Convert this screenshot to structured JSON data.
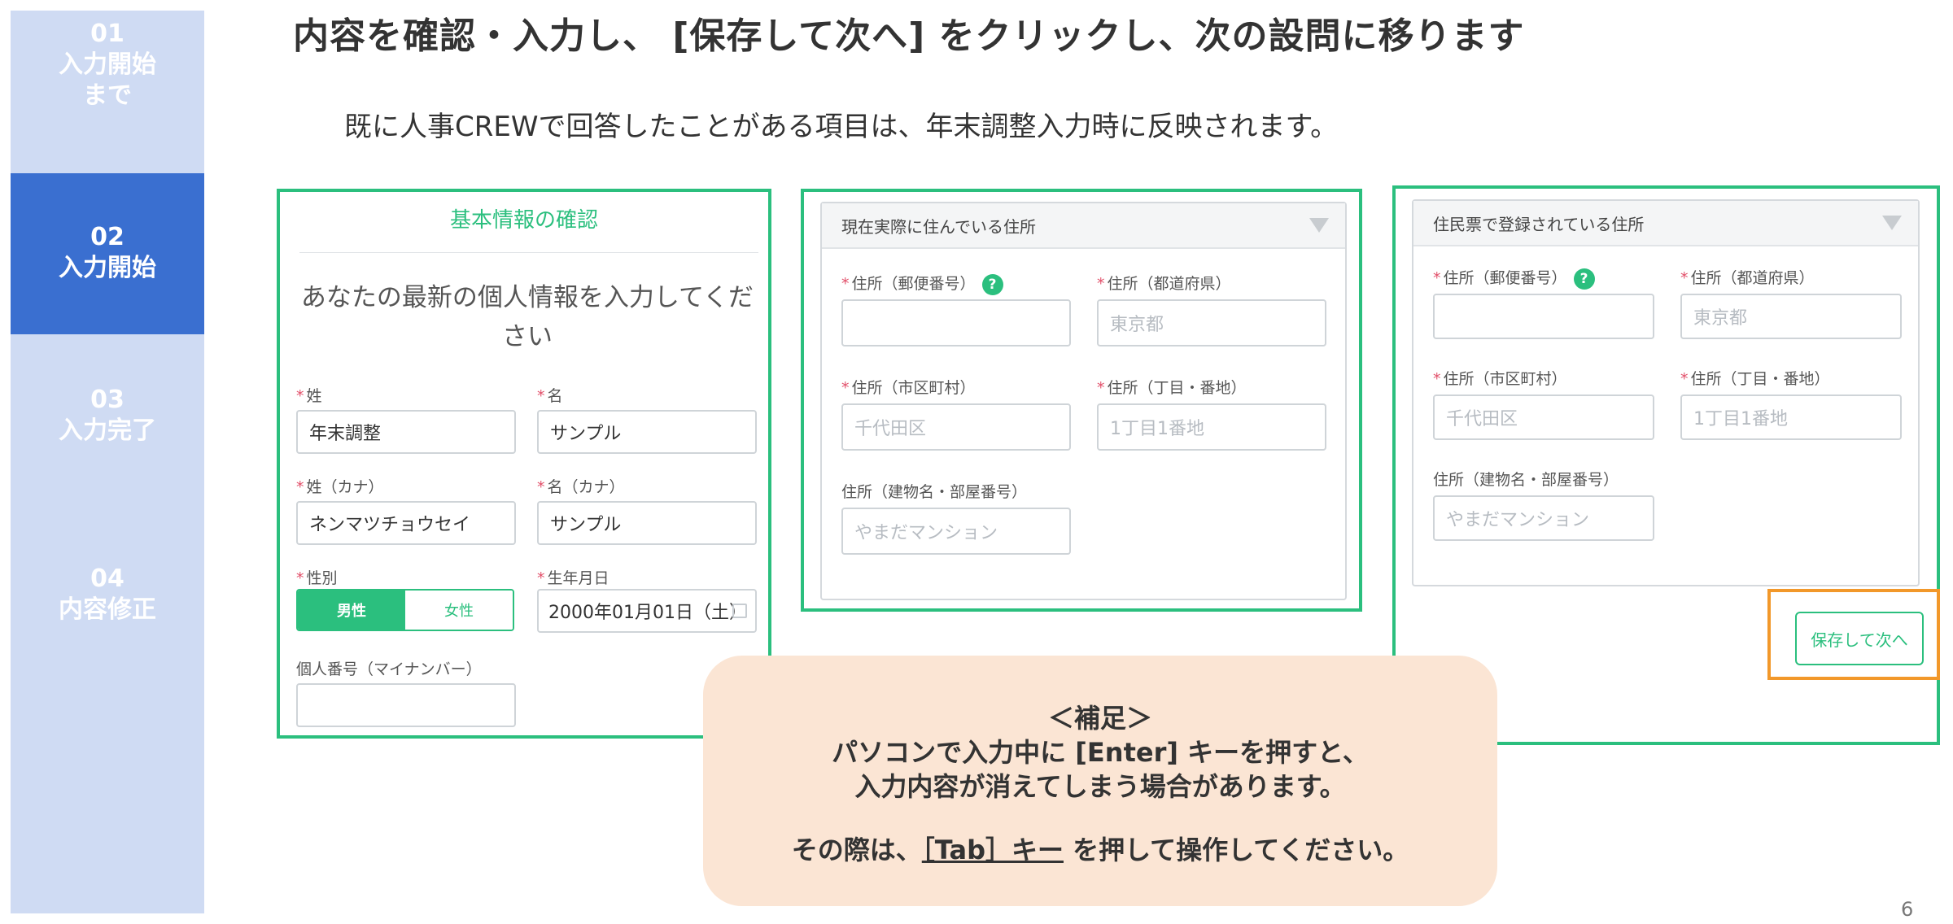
{
  "sidebar": {
    "steps": [
      {
        "num": "01",
        "label_line1": "入力開始",
        "label_line2": "まで"
      },
      {
        "num": "02",
        "label_line1": "入力開始"
      },
      {
        "num": "03",
        "label_line1": "入力完了"
      },
      {
        "num": "04",
        "label_line1": "内容修正"
      }
    ],
    "active_color": "#3a6fd0",
    "inactive_color": "#cfdbf3"
  },
  "title": "内容を確認・入力し、 [保存して次へ] をクリックし、次の設問に移ります",
  "subtitle": "既に人事CREWで回答したことがある項目は、年末調整入力時に反映されます。",
  "basic_info": {
    "heading": "基本情報の確認",
    "intro": "あなたの最新の個人情報を入力してください",
    "last_name_label": "姓",
    "last_name_value": "年末調整",
    "first_name_label": "名",
    "first_name_value": "サンプル",
    "last_kana_label": "姓（カナ）",
    "last_kana_value": "ネンマツチョウセイ",
    "first_kana_label": "名（カナ）",
    "first_kana_value": "サンプル",
    "gender_label": "性別",
    "gender_male": "男性",
    "gender_female": "女性",
    "birth_label": "生年月日",
    "birth_value": "2000年01月01日（土）",
    "mynumber_label": "個人番号（マイナンバー）",
    "mynumber_value": ""
  },
  "current_address": {
    "header": "現在実際に住んでいる住所",
    "postal_label": "住所（郵便番号）",
    "pref_label": "住所（都道府県）",
    "pref_placeholder": "東京都",
    "city_label": "住所（市区町村）",
    "city_placeholder": "千代田区",
    "street_label": "住所（丁目・番地）",
    "street_placeholder": "1丁目1番地",
    "building_label": "住所（建物名・部屋番号）",
    "building_placeholder": "やまだマンション",
    "help_symbol": "?"
  },
  "registered_address": {
    "header": "住民票で登録されている住所",
    "postal_label": "住所（郵便番号）",
    "pref_label": "住所（都道府県）",
    "pref_placeholder": "東京都",
    "city_label": "住所（市区町村）",
    "city_placeholder": "千代田区",
    "street_label": "住所（丁目・番地）",
    "street_placeholder": "1丁目1番地",
    "building_label": "住所（建物名・部屋番号）",
    "building_placeholder": "やまだマンション",
    "help_symbol": "?",
    "save_button": "保存して次へ"
  },
  "note": {
    "heading": "＜補足＞",
    "line1": "パソコンで入力中に [Enter] キーを押すと、",
    "line2": "入力内容が消えてしまう場合があります。",
    "line3_prefix": "その際は、",
    "line3_key": "［Tab］キー",
    "line3_suffix": " を押して操作してください。"
  },
  "page_number": "6",
  "colors": {
    "green": "#2bbf7e",
    "orange": "#f2982a",
    "note_bg": "#fbe5d4",
    "required": "#e2506a"
  }
}
